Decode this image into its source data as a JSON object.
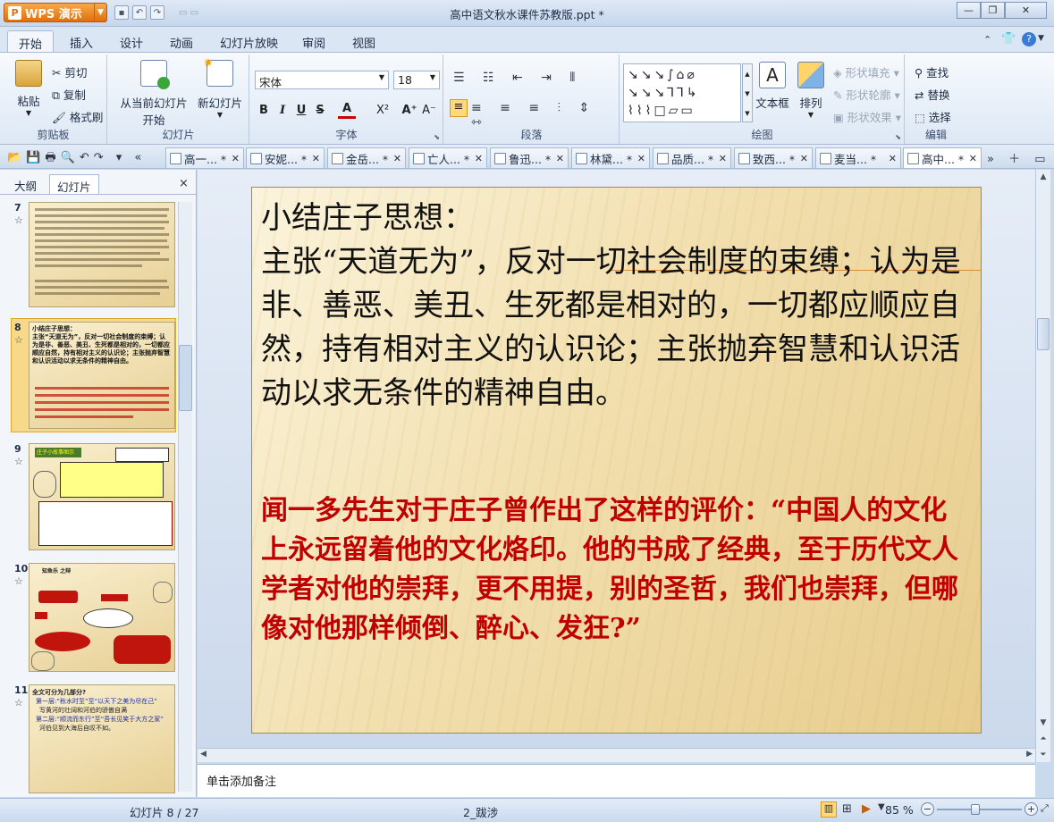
{
  "app": {
    "button_label": "WPS 演示",
    "logo_letter": "P",
    "title": "高中语文秋水课件苏教版.ppt *"
  },
  "menu": {
    "tabs": [
      "开始",
      "插入",
      "设计",
      "动画",
      "幻灯片放映",
      "审阅",
      "视图"
    ],
    "active": "开始"
  },
  "ribbon": {
    "clipboard": {
      "label": "剪贴板",
      "paste": "粘贴",
      "cut": "剪切",
      "copy": "复制",
      "format_painter": "格式刷"
    },
    "slides": {
      "label": "幻灯片",
      "from_current": "从当前幻灯片",
      "from_current_2": "开始",
      "new_slide": "新幻灯片"
    },
    "font": {
      "label": "字体",
      "name": "宋体",
      "size": "18",
      "bold": "B",
      "italic": "I",
      "underline": "U",
      "strike": "S",
      "color": "A",
      "sup": "X²",
      "grow": "A⁺",
      "shrink": "A⁻"
    },
    "paragraph": {
      "label": "段落"
    },
    "drawing": {
      "label": "绘图",
      "textbox": "文本框",
      "arrange": "排列",
      "fill": "形状填充",
      "outline": "形状轮廓",
      "effect": "形状效果"
    },
    "edit": {
      "label": "编辑",
      "find": "查找",
      "replace": "替换",
      "select": "选择"
    }
  },
  "doc_tabs": [
    "高一... *",
    "安妮... *",
    "金岳... *",
    "亡人... *",
    "鲁迅... *",
    "林黛... *",
    "品质... *",
    "致西... *",
    "麦当... *",
    "高中... *"
  ],
  "panel": {
    "tab_outline": "大纲",
    "tab_slides": "幻灯片",
    "close": "×"
  },
  "thumbs": [
    {
      "num": "7"
    },
    {
      "num": "8",
      "text1": "小结庄子思想：",
      "text2": "主张“天道无为”，反对一切社会制度的束缚；认为是非、善恶、美丑、生死都是相对的，一切都应顺应自然，持有相对主义的认识论；主张抛弃智慧和认识活动以求无条件的精神自由。"
    },
    {
      "num": "9",
      "title": "庄子小故事图示"
    },
    {
      "num": "10",
      "title": "知鱼乐 之辩"
    },
    {
      "num": "11",
      "title": "全文可分为几部分?",
      "l1": "第一层:“秋水时至”至“以天下之美为尽在己”",
      "l2": "写黄河的壮阔和河伯的骄傲自满",
      "l3": "第二层:“顺流而东行”至“吾长见笑于大方之家”",
      "l4": "河伯见到大海后自叹不如。"
    }
  ],
  "slide": {
    "title": "小结庄子思想：",
    "body": "主张“天道无为”，反对一切社会制度的束缚；认为是非、善恶、美丑、生死都是相对的，一切都应顺应自然，持有相对主义的认识论；主张抛弃智慧和认识活动以求无条件的精神自由。",
    "quote": "闻一多先生对于庄子曾作出了这样的评价：“中国人的文化上永远留着他的文化烙印。他的书成了经典，至于历代文人学者对他的崇拜，更不用提，别的圣哲，我们也崇拜，但哪像对他那样倾倒、醉心、发狂?”"
  },
  "notes": {
    "placeholder": "单击添加备注"
  },
  "status": {
    "slide_pos": "幻灯片 8 / 27",
    "template": "2_跋涉",
    "zoom": "85 %",
    "zoom_level": 0.45
  },
  "colors": {
    "accent": "#e26f0b",
    "quote": "#c00000"
  }
}
